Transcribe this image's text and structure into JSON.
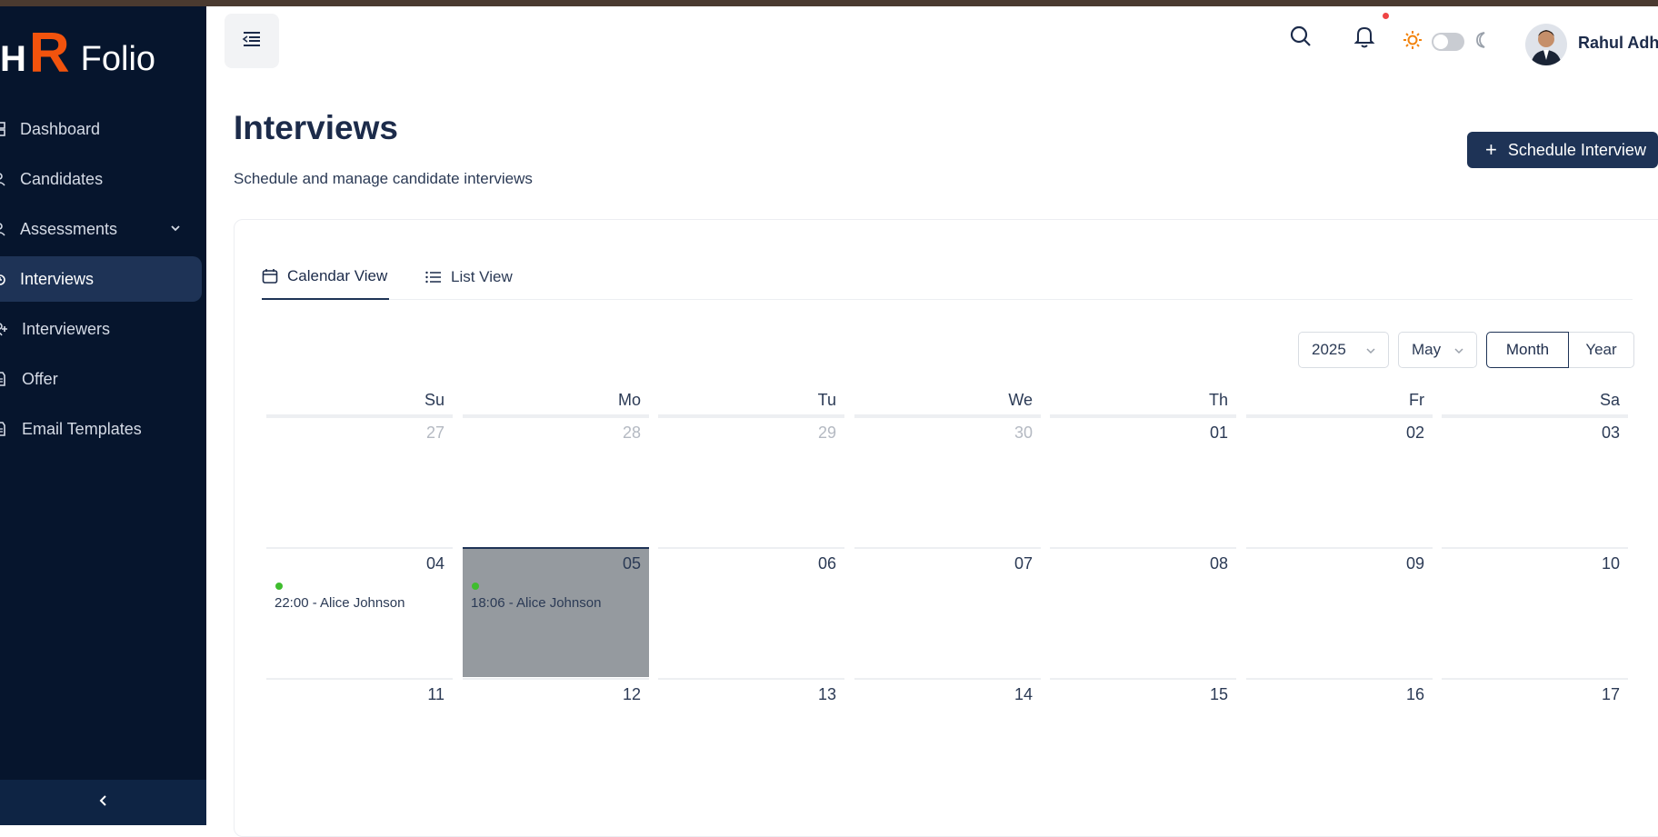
{
  "brand": {
    "h": "H",
    "r": "R",
    "folio": "Folio"
  },
  "sidebar": {
    "items": [
      {
        "label": "Dashboard",
        "icon": "dashboard-icon"
      },
      {
        "label": "Candidates",
        "icon": "users-icon"
      },
      {
        "label": "Assessments",
        "icon": "user-icon",
        "has_submenu": true
      },
      {
        "label": "Interviews",
        "icon": "interview-icon",
        "active": true
      },
      {
        "label": "Interviewers",
        "icon": "user-plus-icon"
      },
      {
        "label": "Offer",
        "icon": "document-icon"
      },
      {
        "label": "Email Templates",
        "icon": "document-icon"
      }
    ]
  },
  "header": {
    "user_name": "Rahul Adhi",
    "notification_dot_color": "#ef4444",
    "theme_toggle": "light"
  },
  "page": {
    "title": "Interviews",
    "subtitle": "Schedule and manage candidate interviews",
    "schedule_button": "Schedule Interview"
  },
  "tabs": [
    {
      "label": "Calendar View",
      "active": true
    },
    {
      "label": "List View",
      "active": false
    }
  ],
  "controls": {
    "year": "2025",
    "month": "May",
    "modes": [
      "Month",
      "Year"
    ],
    "selected_mode": "Month"
  },
  "calendar": {
    "weekdays": [
      "Su",
      "Mo",
      "Tu",
      "We",
      "Th",
      "Fr",
      "Sa"
    ],
    "weeks": [
      [
        {
          "d": "27",
          "m": true
        },
        {
          "d": "28",
          "m": true
        },
        {
          "d": "29",
          "m": true
        },
        {
          "d": "30",
          "m": true
        },
        {
          "d": "01"
        },
        {
          "d": "02"
        },
        {
          "d": "03"
        }
      ],
      [
        {
          "d": "04",
          "event": "22:00 - Alice Johnson"
        },
        {
          "d": "05",
          "event": "18:06 - Alice Johnson",
          "selected": true
        },
        {
          "d": "06"
        },
        {
          "d": "07"
        },
        {
          "d": "08"
        },
        {
          "d": "09"
        },
        {
          "d": "10"
        }
      ],
      [
        {
          "d": "11"
        },
        {
          "d": "12"
        },
        {
          "d": "13"
        },
        {
          "d": "14"
        },
        {
          "d": "15"
        },
        {
          "d": "16"
        },
        {
          "d": "17"
        }
      ]
    ]
  },
  "colors": {
    "sidebar": "#06152d",
    "accent": "#1e3356",
    "brand_r": "#f2530d",
    "event_dot": "#3fbd2e"
  }
}
